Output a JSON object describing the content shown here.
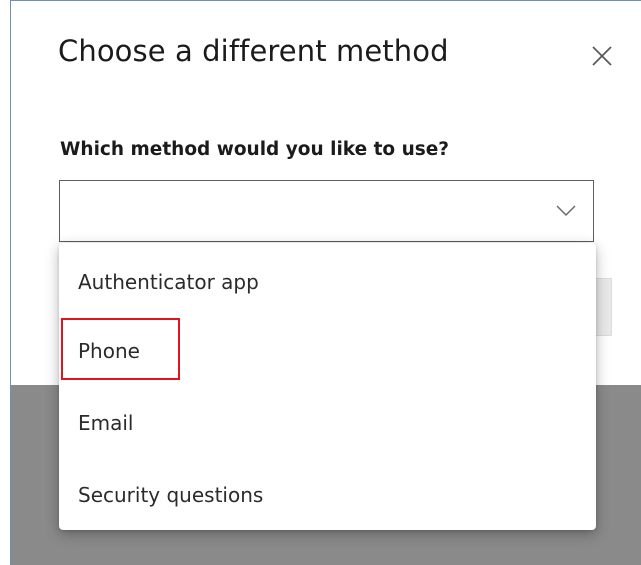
{
  "dialog": {
    "title": "Choose a different method",
    "close_icon": "close-icon",
    "question": "Which method would you like to use?",
    "select": {
      "value": "",
      "chevron_icon": "chevron-down-icon",
      "options": [
        "Authenticator app",
        "Phone",
        "Email",
        "Security questions"
      ]
    }
  },
  "annotation": {
    "highlighted_option": "Phone",
    "color": "#e3141b"
  },
  "colors": {
    "backdrop": "#8a8a8a",
    "border_accent": "#6f8fb9",
    "text": "#1b1b1b"
  }
}
